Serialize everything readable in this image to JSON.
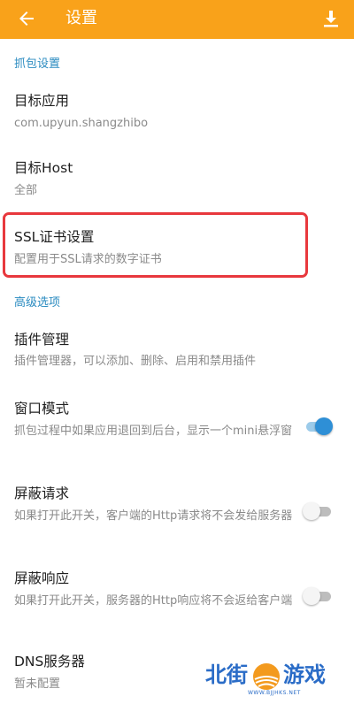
{
  "appbar": {
    "title": "设置",
    "back_icon": "arrow-left-icon",
    "download_icon": "download-icon",
    "color": "#F9A21A"
  },
  "sections": {
    "capture": "抓包设置",
    "advanced": "高级选项"
  },
  "items": {
    "target_app": {
      "title": "目标应用",
      "summary": "com.upyun.shangzhibo"
    },
    "target_host": {
      "title": "目标Host",
      "summary": "全部"
    },
    "ssl": {
      "title": "SSL证书设置",
      "summary": "配置用于SSL请求的数字证书"
    },
    "plugins": {
      "title": "插件管理",
      "summary": "插件管理器，可以添加、删除、启用和禁用插件"
    },
    "window_mode": {
      "title": "窗口模式",
      "summary": "抓包过程中如果应用退回到后台，显示一个mini悬浮窗",
      "enabled": true
    },
    "block_request": {
      "title": "屏蔽请求",
      "summary": "如果打开此开关，客户端的Http请求将不会发给服务器",
      "enabled": false
    },
    "block_response": {
      "title": "屏蔽响应",
      "summary": "如果打开此开关，服务器的Http响应将不会返给客户端",
      "enabled": false
    },
    "dns": {
      "title": "DNS服务器",
      "summary": "暂未配置"
    }
  },
  "watermark": {
    "text_left": "北街",
    "text_right": "游戏",
    "url": "WWW.BJJHKS.NET"
  },
  "colors": {
    "accent": "#F9A21A",
    "section_header": "#2A8BC0",
    "highlight_border": "#E8383D",
    "switch_on": "#2E8FD6"
  }
}
